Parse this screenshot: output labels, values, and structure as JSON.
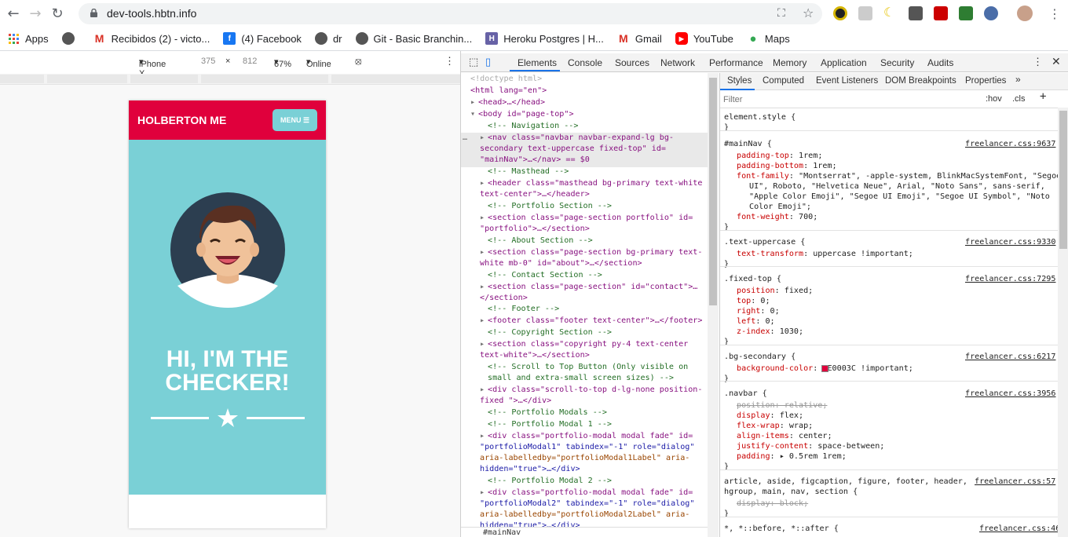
{
  "browser": {
    "url": "dev-tools.hbtn.info",
    "bookmarks": [
      "Apps",
      "Recibidos (2) - victo...",
      "(4) Facebook",
      "dr",
      "Git - Basic Branchin...",
      "Heroku Postgres | H...",
      "Gmail",
      "YouTube",
      "Maps"
    ]
  },
  "device_toolbar": {
    "device": "iPhone X",
    "width": "375",
    "times": "×",
    "height": "812",
    "zoom": "67%",
    "throttle": "Online"
  },
  "page": {
    "brand": "HOLBERTON ME",
    "menu": "MENU",
    "heading_line1": "HI, I'M THE",
    "heading_line2": "CHECKER!"
  },
  "devtools": {
    "tabs": [
      "Elements",
      "Console",
      "Sources",
      "Network",
      "Performance",
      "Memory",
      "Application",
      "Security",
      "Audits"
    ],
    "style_tabs": [
      "Styles",
      "Computed",
      "Event Listeners",
      "DOM Breakpoints",
      "Properties"
    ],
    "filter_placeholder": "Filter",
    "hov": ":hov",
    "cls": ".cls",
    "breadcrumb": "#mainNav",
    "dom_lines": [
      "<!doctype html>",
      "<html lang=\"en\">",
      "<head>…</head>",
      "<body id=\"page-top\">",
      "<!-- Navigation -->",
      "<nav class=\"navbar navbar-expand-lg bg-",
      "secondary text-uppercase fixed-top\" id=",
      "\"mainNav\">…</nav> == $0",
      "<!-- Masthead -->",
      "<header class=\"masthead bg-primary text-white",
      "text-center\">…</header>",
      "<!-- Portfolio Section -->",
      "<section class=\"page-section portfolio\" id=",
      "\"portfolio\">…</section>",
      "<!-- About Section -->",
      "<section class=\"page-section bg-primary text-",
      "white mb-0\" id=\"about\">…</section>",
      "<!-- Contact Section -->",
      "<section class=\"page-section\" id=\"contact\">…",
      "</section>",
      "<!-- Footer -->",
      "<footer class=\"footer text-center\">…</footer>",
      "<!-- Copyright Section -->",
      "<section class=\"copyright py-4 text-center",
      "text-white\">…</section>",
      "<!-- Scroll to Top Button (Only visible on",
      "small and extra-small screen sizes) -->",
      "<div class=\"scroll-to-top d-lg-none position-",
      "fixed \">…</div>",
      "<!-- Portfolio Modals -->",
      "<!-- Portfolio Modal 1 -->",
      "<div class=\"portfolio-modal modal fade\" id=",
      "\"portfolioModal1\" tabindex=\"-1\" role=\"dialog\"",
      "aria-labelledby=\"portfolioModal1Label\" aria-",
      "hidden=\"true\">…</div>",
      "<!-- Portfolio Modal 2 -->",
      "<div class=\"portfolio-modal modal fade\" id=",
      "\"portfolioModal2\" tabindex=\"-1\" role=\"dialog\"",
      "aria-labelledby=\"portfolioModal2Label\" aria-",
      "hidden=\"true\">…</div>"
    ],
    "style_lines": [
      "element.style {",
      "}",
      "#mainNav {",
      "padding-top: 1rem;",
      "padding-bottom: 1rem;",
      "font-family: \"Montserrat\", -apple-system, BlinkMacSystemFont, \"Segoe",
      "UI\", Roboto, \"Helvetica Neue\", Arial, \"Noto Sans\", sans-serif,",
      "\"Apple Color Emoji\", \"Segoe UI Emoji\", \"Segoe UI Symbol\", \"Noto",
      "Color Emoji\";",
      "font-weight: 700;",
      "}",
      ".text-uppercase {",
      "text-transform: uppercase !important;",
      "}",
      ".fixed-top {",
      "position: fixed;",
      "top: 0;",
      "right: 0;",
      "left: 0;",
      "z-index: 1030;",
      "}",
      ".bg-secondary {",
      "background-color: #E0003C !important;",
      "}",
      ".navbar {",
      "position: relative;",
      "display: flex;",
      "flex-wrap: wrap;",
      "align-items: center;",
      "justify-content: space-between;",
      "padding: ▸ 0.5rem 1rem;",
      "}",
      "article, aside, figcaption, figure, footer, header,",
      "hgroup, main, nav, section {",
      "display: block;",
      "}",
      "*, *::before, *::after {"
    ],
    "sources": [
      "freelancer.css:9637",
      "freelancer.css:9330",
      "freelancer.css:7295",
      "freelancer.css:6217",
      "freelancer.css:3956",
      "freelancer.css:57",
      "freelancer.css:46"
    ]
  },
  "colors": {
    "brand": "#e0003c",
    "masthead": "#7ad0d6"
  }
}
